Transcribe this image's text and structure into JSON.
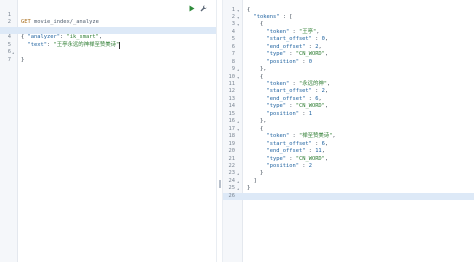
{
  "request": {
    "lines": [
      {
        "num": "1",
        "method": "GET",
        "url": "movie_index/_analyze"
      },
      {
        "num": "2",
        "fold": "▾",
        "open": "{"
      },
      {
        "num": "3",
        "key": "\"analyzer\"",
        "sep": ": ",
        "value": "\"ik_smart\"",
        "tail": ","
      },
      {
        "num": "4",
        "key": "\"text\"",
        "sep": ": ",
        "value": "\"王亭永远的神禅至赞美诗\""
      },
      {
        "num": "5",
        "fold": "▴",
        "close": "}"
      },
      {
        "num": "6"
      },
      {
        "num": "7"
      }
    ]
  },
  "response": {
    "lines": [
      {
        "num": "1",
        "fold": "▾",
        "text": "{"
      },
      {
        "num": "2",
        "fold": "▾",
        "indent": "  ",
        "key": "\"tokens\"",
        "sep": " : ",
        "text": "["
      },
      {
        "num": "3",
        "fold": "▾",
        "indent": "    ",
        "text": "{"
      },
      {
        "num": "4",
        "indent": "      ",
        "key": "\"token\"",
        "sep": " : ",
        "value": "\"王亭\"",
        "tail": ","
      },
      {
        "num": "5",
        "indent": "      ",
        "key": "\"start_offset\"",
        "sep": " : ",
        "nvalue": "0",
        "tail": ","
      },
      {
        "num": "6",
        "indent": "      ",
        "key": "\"end_offset\"",
        "sep": " : ",
        "nvalue": "2",
        "tail": ","
      },
      {
        "num": "7",
        "indent": "      ",
        "key": "\"type\"",
        "sep": " : ",
        "value": "\"CN_WORD\"",
        "tail": ","
      },
      {
        "num": "8",
        "indent": "      ",
        "key": "\"position\"",
        "sep": " : ",
        "nvalue": "0"
      },
      {
        "num": "9",
        "fold": "▴",
        "indent": "    ",
        "text": "},"
      },
      {
        "num": "10",
        "fold": "▾",
        "indent": "    ",
        "text": "{"
      },
      {
        "num": "11",
        "indent": "      ",
        "key": "\"token\"",
        "sep": " : ",
        "value": "\"永远的神\"",
        "tail": ","
      },
      {
        "num": "12",
        "indent": "      ",
        "key": "\"start_offset\"",
        "sep": " : ",
        "nvalue": "2",
        "tail": ","
      },
      {
        "num": "13",
        "indent": "      ",
        "key": "\"end_offset\"",
        "sep": " : ",
        "nvalue": "6",
        "tail": ","
      },
      {
        "num": "14",
        "indent": "      ",
        "key": "\"type\"",
        "sep": " : ",
        "value": "\"CN_WORD\"",
        "tail": ","
      },
      {
        "num": "15",
        "indent": "      ",
        "key": "\"position\"",
        "sep": " : ",
        "nvalue": "1"
      },
      {
        "num": "16",
        "fold": "▴",
        "indent": "    ",
        "text": "},"
      },
      {
        "num": "17",
        "fold": "▾",
        "indent": "    ",
        "text": "{"
      },
      {
        "num": "18",
        "indent": "      ",
        "key": "\"token\"",
        "sep": " : ",
        "value": "\"禅至赞美诗\"",
        "tail": ","
      },
      {
        "num": "19",
        "indent": "      ",
        "key": "\"start_offset\"",
        "sep": " : ",
        "nvalue": "6",
        "tail": ","
      },
      {
        "num": "20",
        "indent": "      ",
        "key": "\"end_offset\"",
        "sep": " : ",
        "nvalue": "11",
        "tail": ","
      },
      {
        "num": "21",
        "indent": "      ",
        "key": "\"type\"",
        "sep": " : ",
        "value": "\"CN_WORD\"",
        "tail": ","
      },
      {
        "num": "22",
        "indent": "      ",
        "key": "\"position\"",
        "sep": " : ",
        "nvalue": "2"
      },
      {
        "num": "23",
        "fold": "▴",
        "indent": "    ",
        "text": "}"
      },
      {
        "num": "24",
        "fold": "▴",
        "indent": "  ",
        "text": "]"
      },
      {
        "num": "25",
        "fold": "▴",
        "text": "}"
      },
      {
        "num": "26"
      }
    ]
  },
  "colors": {
    "play": "#2e8b3a",
    "wrench": "#5b6776"
  },
  "icons": {
    "run": "play-icon",
    "settings": "wrench-icon"
  }
}
